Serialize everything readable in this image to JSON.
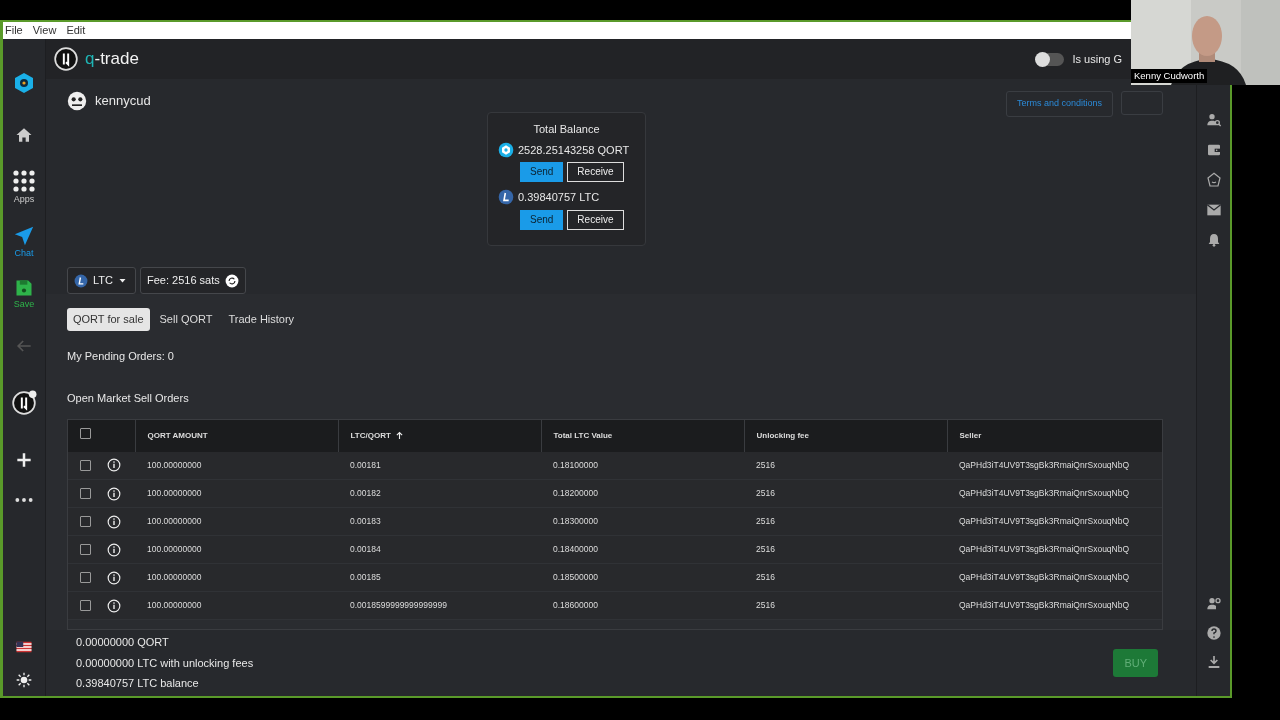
{
  "menu": [
    "File",
    "View",
    "Edit"
  ],
  "left_nav": [
    {
      "kind": "qortal"
    },
    {
      "kind": "home"
    },
    {
      "kind": "apps",
      "label": "Apps"
    },
    {
      "kind": "chat",
      "label": "Chat"
    },
    {
      "kind": "save",
      "label": "Save"
    },
    {
      "kind": "back"
    },
    {
      "kind": "qtrade"
    },
    {
      "kind": "plus"
    },
    {
      "kind": "more"
    }
  ],
  "left_nav_bottom": [
    {
      "kind": "flag"
    },
    {
      "kind": "sun"
    }
  ],
  "app": {
    "title": "q-trade"
  },
  "gateway_toggle": {
    "label": "Is using G",
    "on": false
  },
  "user": {
    "name": "kennycud"
  },
  "terms_button": "Terms and conditions",
  "balance": {
    "title": "Total Balance",
    "assets": [
      {
        "kind": "qort",
        "amount": "2528.25143258 QORT",
        "send": "Send",
        "receive": "Receive"
      },
      {
        "kind": "ltc",
        "amount": "0.39840757 LTC",
        "send": "Send",
        "receive": "Receive"
      }
    ]
  },
  "coin_select": {
    "value": "LTC"
  },
  "fee": "Fee: 2516 sats",
  "tabs": [
    {
      "label": "QORT for sale",
      "selected": true
    },
    {
      "label": "Sell QORT",
      "selected": false
    },
    {
      "label": "Trade History",
      "selected": false
    }
  ],
  "pending": "My Pending Orders: 0",
  "section_title": "Open Market Sell Orders",
  "table": {
    "select_all": false,
    "columns": [
      {
        "label": "QORT AMOUNT",
        "sorted": false
      },
      {
        "label": "LTC/QORT",
        "sorted": true
      },
      {
        "label": "Total LTC Value",
        "sorted": false
      },
      {
        "label": "Unlocking fee",
        "sorted": false
      },
      {
        "label": "Seller",
        "sorted": false
      }
    ],
    "rows": [
      {
        "checked": false,
        "cells": [
          "100.00000000",
          "0.00181",
          "0.18100000",
          "2516",
          "QaPHd3iT4UV9T3sgBk3RmaiQnrSxouqNbQ"
        ]
      },
      {
        "checked": false,
        "cells": [
          "100.00000000",
          "0.00182",
          "0.18200000",
          "2516",
          "QaPHd3iT4UV9T3sgBk3RmaiQnrSxouqNbQ"
        ]
      },
      {
        "checked": false,
        "cells": [
          "100.00000000",
          "0.00183",
          "0.18300000",
          "2516",
          "QaPHd3iT4UV9T3sgBk3RmaiQnrSxouqNbQ"
        ]
      },
      {
        "checked": false,
        "cells": [
          "100.00000000",
          "0.00184",
          "0.18400000",
          "2516",
          "QaPHd3iT4UV9T3sgBk3RmaiQnrSxouqNbQ"
        ]
      },
      {
        "checked": false,
        "cells": [
          "100.00000000",
          "0.00185",
          "0.18500000",
          "2516",
          "QaPHd3iT4UV9T3sgBk3RmaiQnrSxouqNbQ"
        ]
      },
      {
        "checked": false,
        "cells": [
          "100.00000000",
          "0.0018599999999999999",
          "0.18600000",
          "2516",
          "QaPHd3iT4UV9T3sgBk3RmaiQnrSxouqNbQ"
        ]
      }
    ]
  },
  "totals": [
    "0.00000000 QORT",
    "0.00000000 LTC with unlocking fees",
    "0.39840757 LTC balance"
  ],
  "buy_button": {
    "label": "BUY",
    "disabled": true
  },
  "right_nav": [
    {
      "kind": "user-search"
    },
    {
      "kind": "wallet"
    },
    {
      "kind": "hexagon"
    },
    {
      "kind": "mail"
    },
    {
      "kind": "bell"
    }
  ],
  "right_nav_bottom": [
    {
      "kind": "user-gear"
    },
    {
      "kind": "help"
    },
    {
      "kind": "download"
    }
  ],
  "webcam": {
    "kind": "picture",
    "caption": "Kenny Cudworth"
  }
}
